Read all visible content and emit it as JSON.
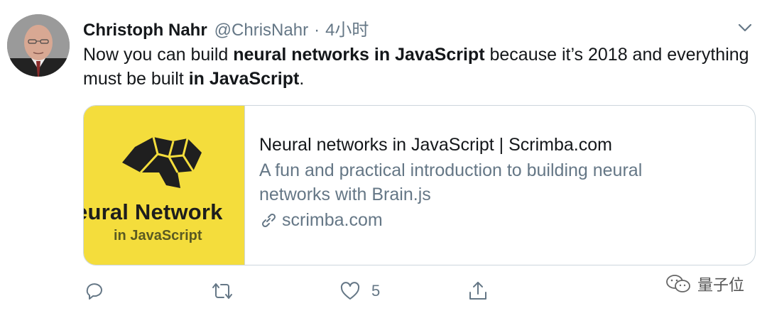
{
  "author": {
    "name": "Christoph Nahr",
    "handle": "@ChrisNahr",
    "separator": "·",
    "timestamp": "4小时"
  },
  "tweet": {
    "text_1": "Now you can build ",
    "bold_1": "neural networks in JavaScript",
    "text_2": " because it’s 2018 and everything must be built ",
    "bold_2": "in JavaScript",
    "text_3": "."
  },
  "card": {
    "image_title": "eural Network",
    "image_subtitle": "in JavaScript",
    "title": "Neural networks in JavaScript | Scrimba.com",
    "description": "A fun and practical introduction to building neural networks with Brain.js",
    "domain": "scrimba.com",
    "image_bg": "#f4dd3c"
  },
  "actions": {
    "reply_count": "",
    "retweet_count": "",
    "like_count": "5"
  },
  "watermark": {
    "text": "量子位"
  },
  "icons": [
    "chevron-down-icon",
    "link-icon",
    "reply-icon",
    "retweet-icon",
    "like-icon",
    "share-icon",
    "wechat-icon"
  ]
}
